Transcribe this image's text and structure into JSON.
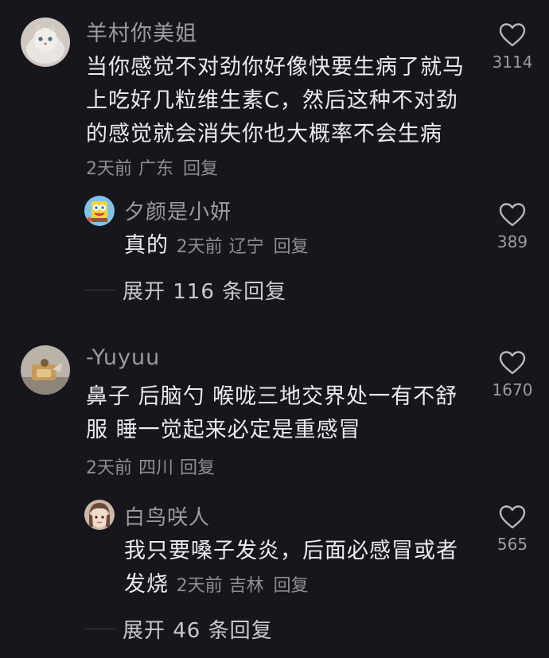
{
  "comments": [
    {
      "username": "羊村你美姐",
      "text": "当你感觉不对劲你好像快要生病了就马上吃好几粒维生素C，然后这种不对劲的感觉就会消失你也大概率不会生病",
      "time": "2天前",
      "location": "广东",
      "reply_label": "回复",
      "likes": "3114",
      "reply": {
        "username": "夕颜是小妍",
        "text": "真的",
        "time": "2天前",
        "location": "辽宁",
        "reply_label": "回复",
        "likes": "389"
      },
      "expand_label": "展开 116 条回复"
    },
    {
      "username": "-Yuyuu",
      "text": "鼻子 后脑勺 喉咙三地交界处一有不舒服 睡一觉起来必定是重感冒",
      "time": "2天前",
      "location": "四川",
      "reply_label": "回复",
      "likes": "1670",
      "reply": {
        "username": "白鸟咲人",
        "text": "我只要嗓子发炎，后面必感冒或者发烧",
        "time": "2天前",
        "location": "吉林",
        "reply_label": "回复",
        "likes": "565"
      },
      "expand_label": "展开 46 条回复"
    }
  ],
  "icons": {
    "like": "heart-outline-icon"
  },
  "colors": {
    "background": "#16161c",
    "text": "#ececef",
    "muted": "#8e8e96"
  }
}
